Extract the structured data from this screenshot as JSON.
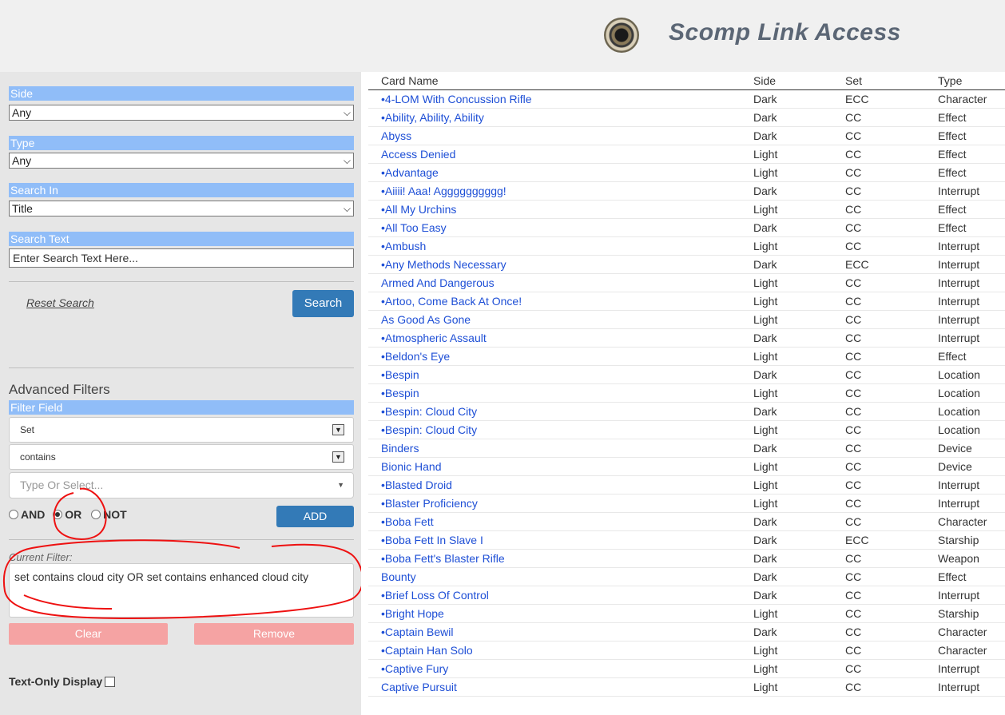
{
  "header": {
    "title": "Scomp Link Access"
  },
  "sidebar": {
    "side": {
      "label": "Side",
      "value": "Any"
    },
    "type": {
      "label": "Type",
      "value": "Any"
    },
    "search_in": {
      "label": "Search In",
      "value": "Title"
    },
    "search_text": {
      "label": "Search Text",
      "placeholder": "Enter Search Text Here..."
    },
    "reset_label": "Reset Search",
    "search_label": "Search",
    "advanced": {
      "title": "Advanced Filters",
      "filter_field_label": "Filter Field",
      "field_value": "Set",
      "operator_value": "contains",
      "type_placeholder": "Type Or Select...",
      "and_label": "AND",
      "or_label": "OR",
      "not_label": "NOT",
      "selected_logic": "OR",
      "add_label": "ADD",
      "current_filter_label": "Current Filter:",
      "current_filter_value": "set contains cloud city OR set contains enhanced cloud city",
      "clear_label": "Clear",
      "remove_label": "Remove"
    },
    "text_only_label": "Text-Only Display"
  },
  "results": {
    "columns": [
      "Card Name",
      "Side",
      "Set",
      "Type"
    ],
    "rows": [
      [
        "•4-LOM With Concussion Rifle",
        "Dark",
        "ECC",
        "Character"
      ],
      [
        "•Ability, Ability, Ability",
        "Dark",
        "CC",
        "Effect"
      ],
      [
        "Abyss",
        "Dark",
        "CC",
        "Effect"
      ],
      [
        "Access Denied",
        "Light",
        "CC",
        "Effect"
      ],
      [
        "•Advantage",
        "Light",
        "CC",
        "Effect"
      ],
      [
        "•Aiiii! Aaa! Agggggggggg!",
        "Dark",
        "CC",
        "Interrupt"
      ],
      [
        "•All My Urchins",
        "Light",
        "CC",
        "Effect"
      ],
      [
        "•All Too Easy",
        "Dark",
        "CC",
        "Effect"
      ],
      [
        "•Ambush",
        "Light",
        "CC",
        "Interrupt"
      ],
      [
        "•Any Methods Necessary",
        "Dark",
        "ECC",
        "Interrupt"
      ],
      [
        "Armed And Dangerous",
        "Light",
        "CC",
        "Interrupt"
      ],
      [
        "•Artoo, Come Back At Once!",
        "Light",
        "CC",
        "Interrupt"
      ],
      [
        "As Good As Gone",
        "Light",
        "CC",
        "Interrupt"
      ],
      [
        "•Atmospheric Assault",
        "Dark",
        "CC",
        "Interrupt"
      ],
      [
        "•Beldon's Eye",
        "Light",
        "CC",
        "Effect"
      ],
      [
        "•Bespin",
        "Dark",
        "CC",
        "Location"
      ],
      [
        "•Bespin",
        "Light",
        "CC",
        "Location"
      ],
      [
        "•Bespin: Cloud City",
        "Dark",
        "CC",
        "Location"
      ],
      [
        "•Bespin: Cloud City",
        "Light",
        "CC",
        "Location"
      ],
      [
        "Binders",
        "Dark",
        "CC",
        "Device"
      ],
      [
        "Bionic Hand",
        "Light",
        "CC",
        "Device"
      ],
      [
        "•Blasted Droid",
        "Light",
        "CC",
        "Interrupt"
      ],
      [
        "•Blaster Proficiency",
        "Light",
        "CC",
        "Interrupt"
      ],
      [
        "•Boba Fett",
        "Dark",
        "CC",
        "Character"
      ],
      [
        "•Boba Fett In Slave I",
        "Dark",
        "ECC",
        "Starship"
      ],
      [
        "•Boba Fett's Blaster Rifle",
        "Dark",
        "CC",
        "Weapon"
      ],
      [
        "Bounty",
        "Dark",
        "CC",
        "Effect"
      ],
      [
        "•Brief Loss Of Control",
        "Dark",
        "CC",
        "Interrupt"
      ],
      [
        "•Bright Hope",
        "Light",
        "CC",
        "Starship"
      ],
      [
        "•Captain Bewil",
        "Dark",
        "CC",
        "Character"
      ],
      [
        "•Captain Han Solo",
        "Light",
        "CC",
        "Character"
      ],
      [
        "•Captive Fury",
        "Light",
        "CC",
        "Interrupt"
      ],
      [
        "Captive Pursuit",
        "Light",
        "CC",
        "Interrupt"
      ]
    ]
  }
}
